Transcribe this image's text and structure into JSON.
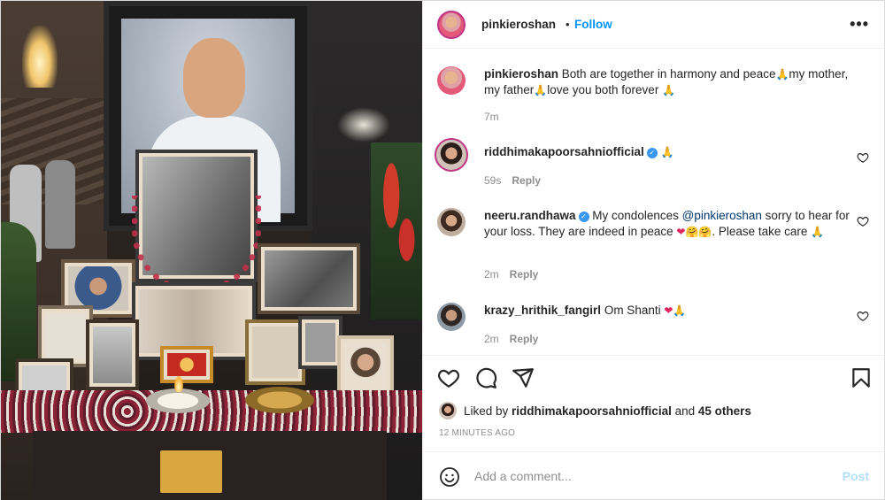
{
  "post": {
    "username": "pinkieroshan",
    "separator": "•",
    "follow_label": "Follow",
    "more_label": "•••"
  },
  "caption": {
    "username": "pinkieroshan",
    "text_1": "Both are together in harmony and peace",
    "text_2": "my mother, my father",
    "text_3": "love you both forever",
    "time": "7m"
  },
  "comments": [
    {
      "username": "riddhimakapoorsahniofficial",
      "verified": true,
      "time": "59s",
      "reply_label": "Reply"
    },
    {
      "username": "neeru.randhawa",
      "verified": true,
      "text_1": "My condolences ",
      "mention": "@pinkieroshan",
      "text_2": " sorry to hear for your loss. They are indeed in peace ",
      "text_3": ". Please take care ",
      "time": "2m",
      "reply_label": "Reply"
    },
    {
      "username": "krazy_hrithik_fangirl",
      "text": "Om Shanti ",
      "time": "2m",
      "reply_label": "Reply"
    }
  ],
  "likes": {
    "prefix": "Liked by ",
    "user": "riddhimakapoorsahniofficial",
    "middle": " and ",
    "others": "45 others"
  },
  "time_ago": "12 MINUTES AGO",
  "add_comment": {
    "placeholder": "Add a comment...",
    "post_label": "Post"
  },
  "emoji": {
    "pray": "🙏",
    "heart": "❤",
    "hug": "🤗"
  },
  "icons": [
    "heart-icon",
    "comment-icon",
    "share-icon",
    "bookmark-icon",
    "emoji-icon",
    "more-icon",
    "verified-icon"
  ],
  "colors": {
    "follow": "#0095f6",
    "text": "#262626",
    "muted": "#8e8e8e",
    "post_disabled": "#b2dffc",
    "mention": "#00376b"
  }
}
